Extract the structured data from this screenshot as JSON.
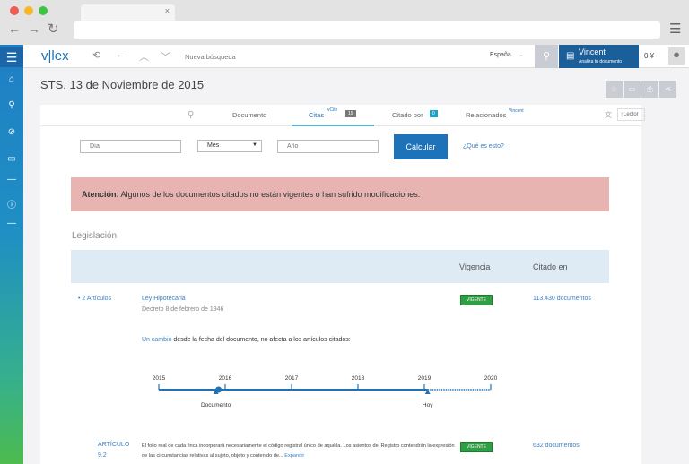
{
  "browser": {
    "tab_close": "×"
  },
  "header": {
    "logo": "v|lex",
    "search_placeholder": "Nueva búsqueda",
    "country": "España",
    "vincent_title": "Vincent",
    "vincent_sub": "Analiza tu documento",
    "credits": "0 ¥"
  },
  "page": {
    "title": "STS, 13 de Noviembre de 2015"
  },
  "tabs": [
    {
      "label": "Documento"
    },
    {
      "label": "Citas",
      "sup": "vCite",
      "count": "19",
      "active": true
    },
    {
      "label": "Citado por",
      "count": "0"
    },
    {
      "label": "Relacionados",
      "sup": "Vincent"
    }
  ],
  "reader_label": "Lector",
  "form": {
    "day_placeholder": "Día",
    "month_value": "Mes",
    "year_placeholder": "Año",
    "calc_label": "Calcular",
    "help_link": "¿Qué es esto?"
  },
  "alert": {
    "strong": "Atención:",
    "text": " Algunos de los documentos citados no están vigentes o han sufrido modificaciones."
  },
  "section_title": "Legislación",
  "table": {
    "col_vigencia": "Vigencia",
    "col_citado": "Citado en"
  },
  "law": {
    "toggle": "• 2 Artículos",
    "name": "Ley Hipotecaria",
    "subtitle": "Decreto 8 de febrero de 1946",
    "status": "VIGENTE",
    "cited": "113.430 documentos"
  },
  "change": {
    "link": "Un cambio",
    "text": " desde la fecha del documento, no afecta a los artículos citados:"
  },
  "timeline": {
    "years": [
      "2015",
      "2016",
      "2017",
      "2018",
      "2019",
      "2020"
    ],
    "document_label": "Documento",
    "document_year": 2015.9,
    "today_label": "Hoy",
    "today_year": 2019.05
  },
  "article": {
    "label1": "ARTÍCULO",
    "label2": "9.2",
    "text": "El folio real de cada finca incorporará necesariamente el código registral único de aquélla. Los asientos del Registro contendrán la expresión de las circunstancias relativas al sujeto, objeto y contenido de...",
    "expand": "Expandir",
    "status": "VIGENTE",
    "cited": "632 documentos"
  },
  "colors": {
    "accent": "#1e72b8",
    "alert_bg": "#e8b4b2",
    "green": "#2f9e44"
  }
}
